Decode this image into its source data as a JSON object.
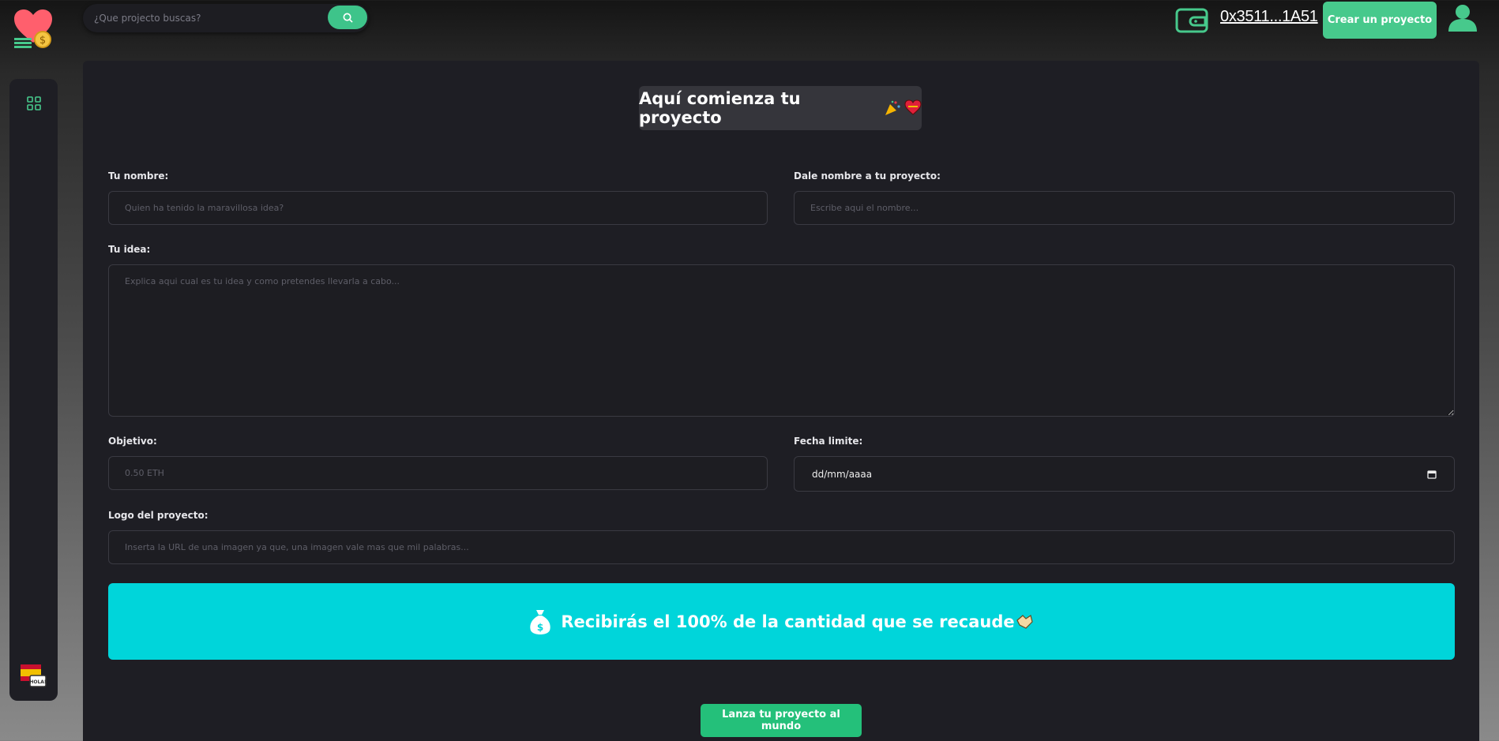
{
  "header": {
    "search_placeholder": "¿Que projecto buscas?",
    "wallet_address": "0x3511...1A51",
    "create_button": "Crear un proyecto"
  },
  "form": {
    "title": "Aquí comienza tu proyecto",
    "name_label": "Tu nombre:",
    "name_placeholder": "Quien ha tenido la maravillosa idea?",
    "project_name_label": "Dale nombre a tu proyecto:",
    "project_name_placeholder": "Escribe aqui el nombre...",
    "idea_label": "Tu idea:",
    "idea_placeholder": "Explica aqui cual es tu idea y como pretendes llevarla a cabo...",
    "goal_label": "Objetivo:",
    "goal_placeholder": "0.50 ETH",
    "deadline_label": "Fecha limite:",
    "deadline_value": "dd/mm/aaaa",
    "logo_label": "Logo del proyecto:",
    "logo_placeholder": "Inserta la URL de una imagen ya que, una imagen vale mas que mil palabras...",
    "banner_text": "Recibirás el 100% de la cantidad que se recaude",
    "submit_button": "Lanza tu proyecto al mundo"
  },
  "colors": {
    "accent": "#47c98c",
    "banner": "#00d5da",
    "panel": "#1e1e24"
  },
  "icons": [
    "heart-coin-logo-icon",
    "search-icon",
    "wallet-icon",
    "user-avatar-icon",
    "grid-icon",
    "spanish-language-icon",
    "party-popper-icon",
    "heart-icon",
    "money-bag-icon",
    "handshake-icon",
    "calendar-icon"
  ]
}
